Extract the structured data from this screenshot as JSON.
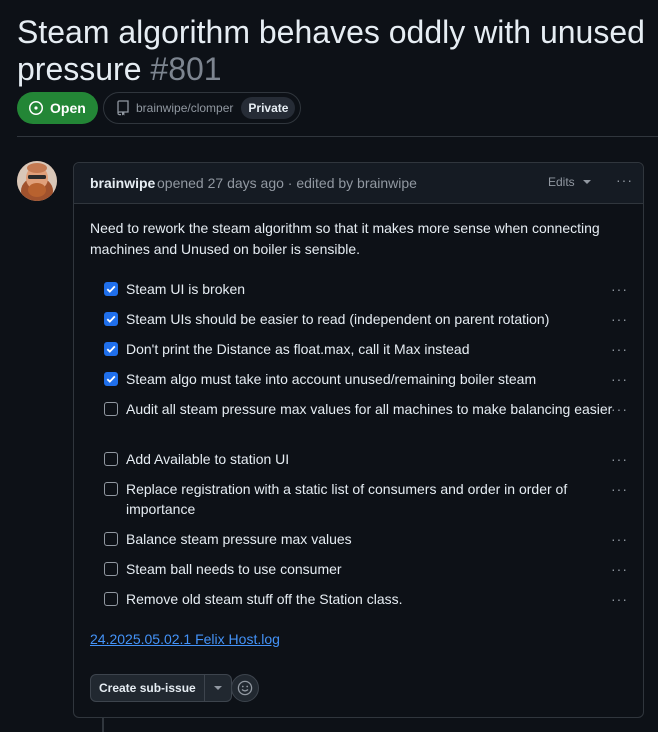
{
  "issue": {
    "title": "Steam algorithm behaves oddly with unused pressure",
    "number": "#801",
    "state": "Open",
    "repo": "brainwipe/clomper",
    "visibility": "Private"
  },
  "comment": {
    "author": "brainwipe",
    "meta": "opened 27 days ago · edited by brainwipe",
    "edits_label": "Edits",
    "more_label": "···",
    "body": "Need to rework the steam algorithm so that it makes more sense when connecting machines and Unused on boiler is sensible.",
    "tasks": [
      {
        "label": "Steam UI is broken",
        "checked": true
      },
      {
        "label": "Steam UIs should be easier to read (independent on parent rotation)",
        "checked": true
      },
      {
        "label": "Don't print the Distance as float.max, call it Max instead",
        "checked": true
      },
      {
        "label": "Steam algo must take into account unused/remaining boiler steam",
        "checked": true
      },
      {
        "label": "Audit all steam pressure max values for all machines to make balancing easier",
        "checked": false
      },
      {
        "label": "Add Available to station UI",
        "checked": false
      },
      {
        "label": "Replace registration with a static list of consumers and order in order of importance",
        "checked": false
      },
      {
        "label": "Balance steam pressure max values",
        "checked": false
      },
      {
        "label": "Steam ball needs to use consumer",
        "checked": false
      },
      {
        "label": "Remove old steam stuff off the Station class.",
        "checked": false
      }
    ],
    "attachment": "24.2025.05.02.1 Felix Host.log",
    "create_subissue_label": "Create sub-issue"
  },
  "colors": {
    "accent_open": "#238636",
    "checkbox_checked": "#1f6feb",
    "link": "#4493f8",
    "background": "#0d1117"
  }
}
